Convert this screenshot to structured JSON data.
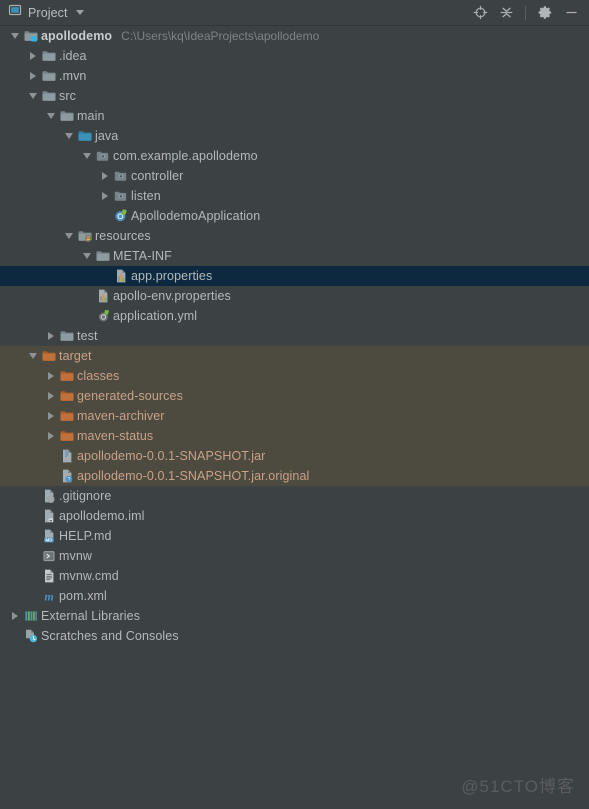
{
  "window": {
    "tool_window_title": "Project",
    "dropdown_icon": "chevron-down-icon",
    "actions": [
      {
        "name": "select-opened-file-icon",
        "label": "Select Opened File"
      },
      {
        "name": "collapse-all-icon",
        "label": "Collapse All"
      },
      {
        "name": "settings-gear-icon",
        "label": "Settings"
      },
      {
        "name": "hide-minimize-icon",
        "label": "Hide"
      }
    ]
  },
  "colors": {
    "background": "#3c4143",
    "header_background": "#3c4143",
    "selection": "#0d293f",
    "excluded_background": "#4d4a40",
    "text": "#b4b9bb",
    "dim_text": "#7e8486",
    "excluded_text": "#c9a287",
    "folder_gray": "#8d9a9e",
    "folder_blue": "#3b92b8",
    "folder_orange": "#c2703a"
  },
  "watermark": "@51CTO博客",
  "tree": {
    "nodes": [
      {
        "id": "apollodemo",
        "label": "apollodemo",
        "sub_label": "C:\\Users\\kq\\IdeaProjects\\apollodemo",
        "depth": 0,
        "state": "expanded",
        "icon": "module-folder-icon",
        "style": "bold"
      },
      {
        "id": "idea",
        "label": ".idea",
        "depth": 1,
        "state": "collapsed",
        "icon": "folder-gray-icon"
      },
      {
        "id": "mvn",
        "label": ".mvn",
        "depth": 1,
        "state": "collapsed",
        "icon": "folder-gray-icon"
      },
      {
        "id": "src",
        "label": "src",
        "depth": 1,
        "state": "expanded",
        "icon": "folder-gray-icon"
      },
      {
        "id": "main",
        "label": "main",
        "depth": 2,
        "state": "expanded",
        "icon": "folder-gray-icon"
      },
      {
        "id": "java",
        "label": "java",
        "depth": 3,
        "state": "expanded",
        "icon": "folder-sources-blue-icon"
      },
      {
        "id": "pkg-root",
        "label": "com.example.apollodemo",
        "depth": 4,
        "state": "expanded",
        "icon": "package-icon"
      },
      {
        "id": "pkg-controller",
        "label": "controller",
        "depth": 5,
        "state": "collapsed",
        "icon": "package-icon"
      },
      {
        "id": "pkg-listen",
        "label": "listen",
        "depth": 5,
        "state": "collapsed",
        "icon": "package-icon"
      },
      {
        "id": "app-class",
        "label": "ApollodemoApplication",
        "depth": 5,
        "state": "leaf",
        "icon": "spring-boot-class-icon"
      },
      {
        "id": "resources",
        "label": "resources",
        "depth": 3,
        "state": "expanded",
        "icon": "folder-resources-icon"
      },
      {
        "id": "meta-inf",
        "label": "META-INF",
        "depth": 4,
        "state": "expanded",
        "icon": "folder-gray-icon"
      },
      {
        "id": "app-properties",
        "label": "app.properties",
        "depth": 5,
        "state": "leaf",
        "icon": "properties-file-icon",
        "selected": true
      },
      {
        "id": "apollo-env",
        "label": "apollo-env.properties",
        "depth": 4,
        "state": "leaf",
        "icon": "properties-file-icon"
      },
      {
        "id": "application-yml",
        "label": "application.yml",
        "depth": 4,
        "state": "leaf",
        "icon": "spring-yaml-file-icon"
      },
      {
        "id": "test",
        "label": "test",
        "depth": 2,
        "state": "collapsed",
        "icon": "folder-gray-icon"
      },
      {
        "id": "target",
        "label": "target",
        "depth": 1,
        "state": "expanded",
        "icon": "folder-orange-icon",
        "style": "excluded"
      },
      {
        "id": "classes",
        "label": "classes",
        "depth": 2,
        "state": "collapsed",
        "icon": "folder-orange-icon",
        "style": "excluded"
      },
      {
        "id": "generated-sources",
        "label": "generated-sources",
        "depth": 2,
        "state": "collapsed",
        "icon": "folder-orange-icon",
        "style": "excluded"
      },
      {
        "id": "maven-archiver",
        "label": "maven-archiver",
        "depth": 2,
        "state": "collapsed",
        "icon": "folder-orange-icon",
        "style": "excluded"
      },
      {
        "id": "maven-status",
        "label": "maven-status",
        "depth": 2,
        "state": "collapsed",
        "icon": "folder-orange-icon",
        "style": "excluded"
      },
      {
        "id": "jar",
        "label": "apollodemo-0.0.1-SNAPSHOT.jar",
        "depth": 2,
        "state": "leaf",
        "icon": "jar-archive-icon",
        "style": "excluded"
      },
      {
        "id": "jar-original",
        "label": "apollodemo-0.0.1-SNAPSHOT.jar.original",
        "depth": 2,
        "state": "leaf",
        "icon": "unknown-file-icon",
        "style": "excluded"
      },
      {
        "id": "gitignore",
        "label": ".gitignore",
        "depth": 1,
        "state": "leaf",
        "icon": "ignored-file-icon"
      },
      {
        "id": "iml",
        "label": "apollodemo.iml",
        "depth": 1,
        "state": "leaf",
        "icon": "module-file-icon"
      },
      {
        "id": "help-md",
        "label": "HELP.md",
        "depth": 1,
        "state": "leaf",
        "icon": "markdown-file-icon"
      },
      {
        "id": "mvnw",
        "label": "mvnw",
        "depth": 1,
        "state": "leaf",
        "icon": "shell-script-icon"
      },
      {
        "id": "mvnw-cmd",
        "label": "mvnw.cmd",
        "depth": 1,
        "state": "leaf",
        "icon": "text-file-icon"
      },
      {
        "id": "pom-xml",
        "label": "pom.xml",
        "depth": 1,
        "state": "leaf",
        "icon": "maven-pom-icon"
      },
      {
        "id": "external-libs",
        "label": "External Libraries",
        "depth": 0,
        "state": "collapsed",
        "icon": "libraries-icon"
      },
      {
        "id": "scratches",
        "label": "Scratches and Consoles",
        "depth": 0,
        "state": "leaf",
        "icon": "scratches-icon"
      }
    ]
  }
}
